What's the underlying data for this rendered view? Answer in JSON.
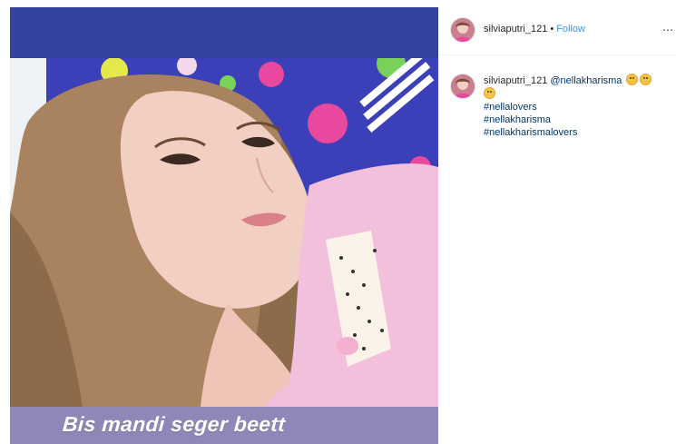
{
  "post": {
    "image_caption": "Bis mandi seger beett",
    "header": {
      "username": "silviaputri_121",
      "separator": "•",
      "follow_label": "Follow"
    },
    "comment": {
      "username": "silviaputri_121",
      "mention": "@nellakharisma",
      "hashtags": [
        "#nellalovers",
        "#nellakharisma",
        "#nellakharismalovers"
      ]
    }
  },
  "colors": {
    "follow": "#3897f0",
    "link": "#003569",
    "caption_band": "#8f87b8",
    "banner_blue": "#33439e"
  }
}
